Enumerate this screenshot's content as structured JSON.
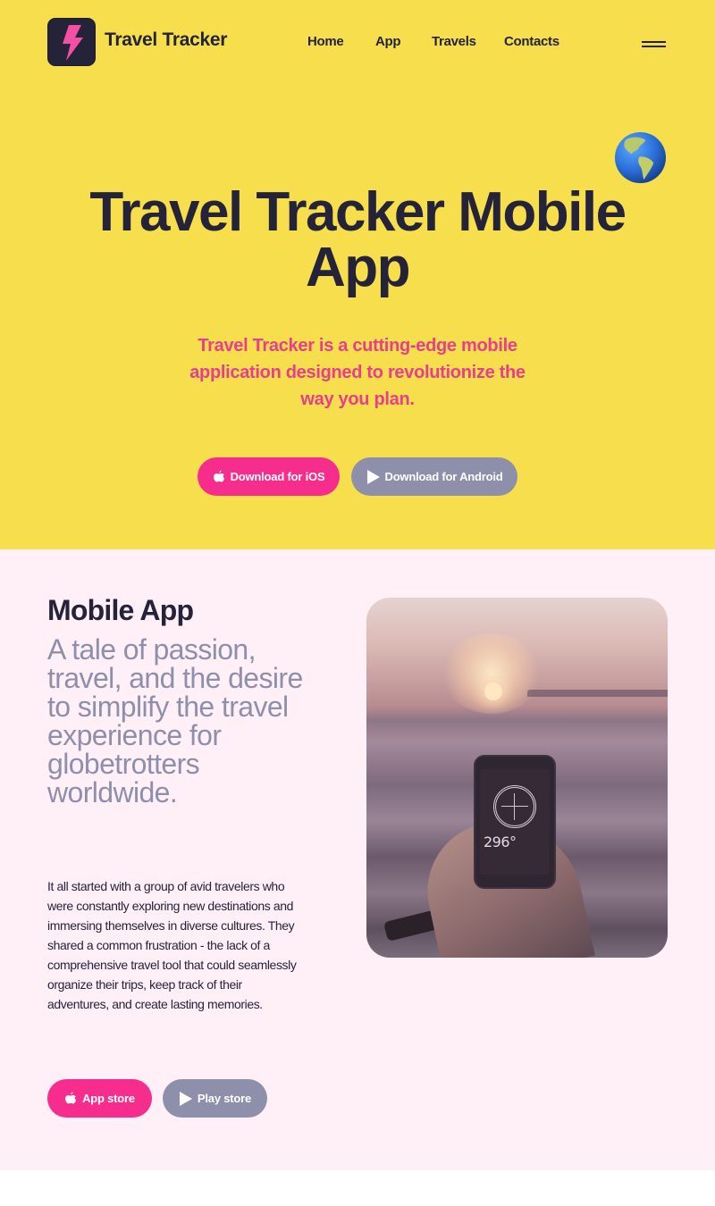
{
  "header": {
    "brand": "Travel Tracker",
    "nav": [
      "Home",
      "App",
      "Travels",
      "Contacts"
    ],
    "logo_icon": "lightning-bolt-icon",
    "menu_icon": "hamburger-menu-icon"
  },
  "hero": {
    "decoration_icon": "globe-americas-icon",
    "title": "Travel Tracker Mobile App",
    "subtitle": "Travel Tracker is a cutting-edge mobile application designed to revolutionize the way you plan.",
    "buttons": [
      {
        "label": "Download for iOS",
        "icon": "apple-icon"
      },
      {
        "label": "Download for Android",
        "icon": "play-icon"
      }
    ]
  },
  "about": {
    "heading": "Mobile App",
    "tagline": "A tale of passion, travel, and the desire to simplify the travel experience for globetrotters worldwide.",
    "body": "It all started with a group of avid travelers who were constantly exploring new destinations and immersing themselves in diverse cultures. They shared a common frustration - the lack of a comprehensive travel tool that could seamlessly organize their trips, keep track of their adventures, and create lasting memories.",
    "buttons": [
      {
        "label": "App store",
        "icon": "apple-icon"
      },
      {
        "label": "Play store",
        "icon": "play-icon"
      }
    ],
    "photo": {
      "description": "hand holding phone with compass app at sunset by the sea",
      "compass_heading": "296°"
    }
  },
  "colors": {
    "hero_bg": "#f6de4d",
    "about_bg": "#fff0f8",
    "dark": "#25233a",
    "accent_pink": "#f62d8c",
    "subtitle_pink": "#e83e8c",
    "muted_grey": "#8e8fab"
  }
}
